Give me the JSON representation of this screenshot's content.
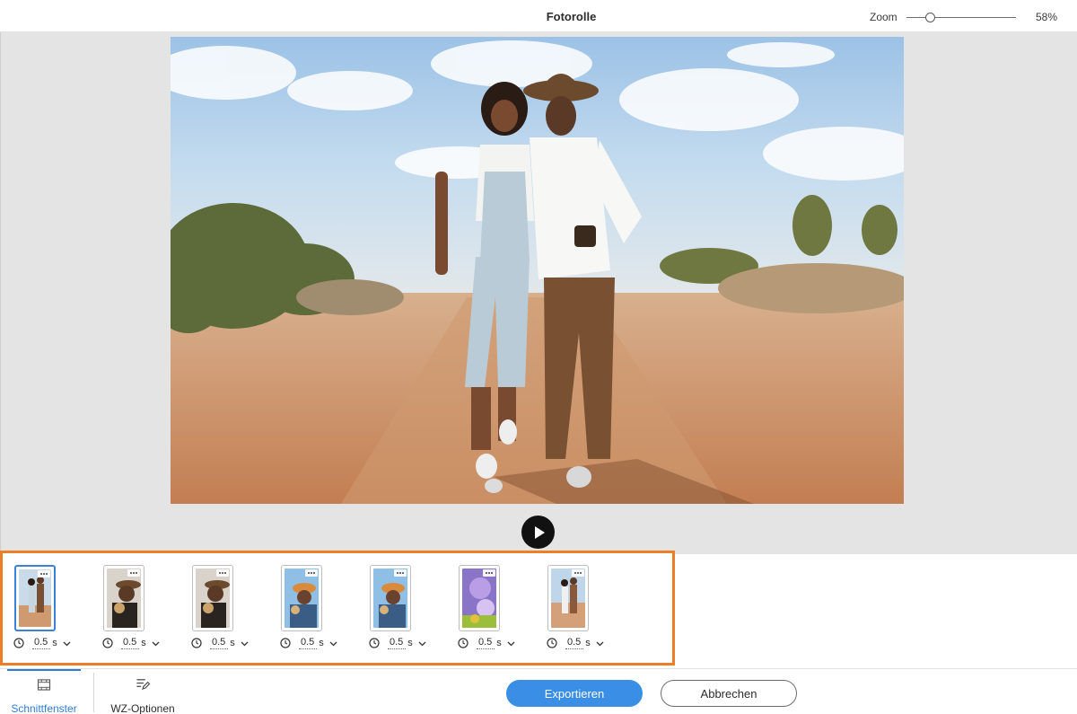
{
  "header": {
    "title": "Fotorolle",
    "zoom_label": "Zoom",
    "zoom_value": "58%",
    "zoom_fraction": 0.22
  },
  "preview": {
    "play_icon": "play-icon"
  },
  "filmstrip": {
    "clips": [
      {
        "duration": "0.5",
        "unit": "s",
        "theme": "couple-walk",
        "selected": true
      },
      {
        "duration": "0.5",
        "unit": "s",
        "theme": "hat-embrace",
        "selected": false
      },
      {
        "duration": "0.5",
        "unit": "s",
        "theme": "hat-embrace",
        "selected": false
      },
      {
        "duration": "0.5",
        "unit": "s",
        "theme": "orange-hat",
        "selected": false
      },
      {
        "duration": "0.5",
        "unit": "s",
        "theme": "orange-hat",
        "selected": false
      },
      {
        "duration": "0.5",
        "unit": "s",
        "theme": "purple-flower",
        "selected": false
      },
      {
        "duration": "0.5",
        "unit": "s",
        "theme": "couple-walk-wide",
        "selected": false
      }
    ]
  },
  "footer": {
    "tab_cut": "Schnittfenster",
    "tab_options": "WZ-Optionen",
    "export_label": "Exportieren",
    "cancel_label": "Abbrechen"
  },
  "colors": {
    "accent": "#3a8ee6",
    "highlight_border": "#ee7d29"
  }
}
